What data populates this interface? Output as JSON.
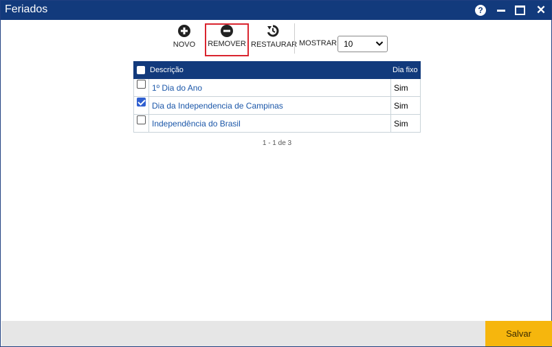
{
  "window": {
    "title": "Feriados",
    "help_glyph": "?",
    "close_glyph": "✕"
  },
  "toolbar": {
    "novo_label": "NOVO",
    "remover_label": "REMOVER",
    "restaurar_label": "RESTAURAR",
    "mostrar_label": "MOSTRAR:",
    "mostrar_value": "10"
  },
  "table": {
    "headers": {
      "descricao": "Descrição",
      "dia_fixo": "Dia fixo"
    },
    "rows": [
      {
        "descricao": "1º Dia do Ano",
        "dia_fixo": "Sim",
        "checked": false
      },
      {
        "descricao": "Dia da Independencia de Campinas",
        "dia_fixo": "Sim",
        "checked": true
      },
      {
        "descricao": "Independência do Brasil",
        "dia_fixo": "Sim",
        "checked": false
      }
    ]
  },
  "pager": {
    "text": "1 - 1 de 3"
  },
  "footer": {
    "save_label": "Salvar"
  },
  "colors": {
    "titlebar": "#123a7c",
    "save_button": "#f6b60d",
    "highlight_border": "#d9232d",
    "link": "#1a56a8"
  },
  "icons": {
    "novo": "plus-circle-icon",
    "remover": "minus-circle-icon",
    "restaurar": "restore-icon"
  }
}
